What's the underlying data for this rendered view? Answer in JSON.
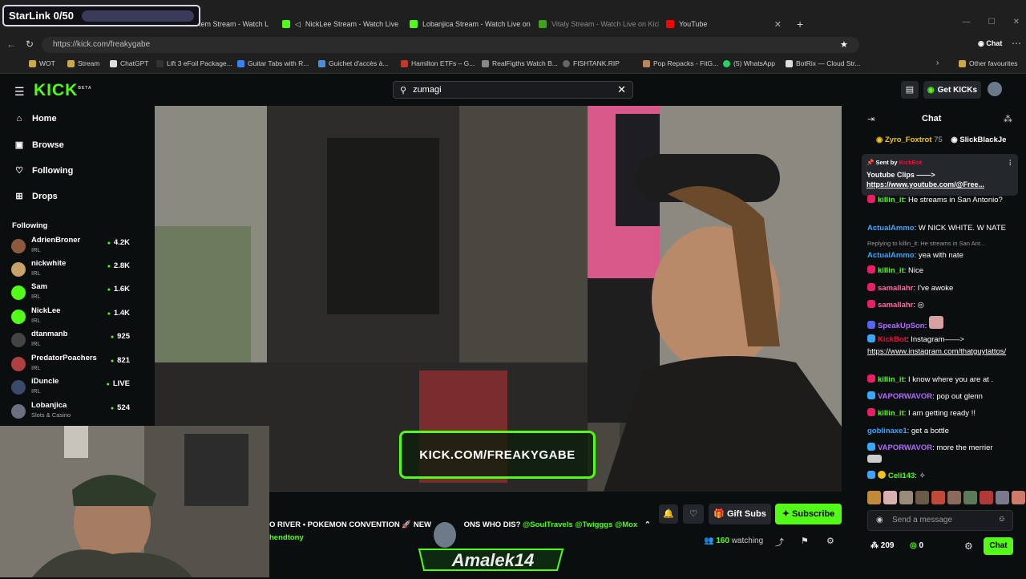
{
  "overlay": {
    "starlink_label": "StarLink 0/50"
  },
  "browser": {
    "tabs": [
      {
        "label": "tem Stream - Watch L",
        "icon_color": "#53fc18"
      },
      {
        "label": "NickLee Stream - Watch Live",
        "icon_color": "#53fc18"
      },
      {
        "label": "Lobanjica Stream - Watch Live on",
        "icon_color": "#53fc18"
      },
      {
        "label": "Vitaly Stream - Watch Live on Kick",
        "icon_color": "#53fc18"
      },
      {
        "label": "YouTube",
        "icon_color": "#ff0000"
      }
    ],
    "url": "https://kick.com/freakygabe",
    "bookmarks": [
      "WOT",
      "Stream",
      "ChatGPT",
      "Lift 3 eFoil Package...",
      "Guitar Tabs with R...",
      "Guichet d'accès à...",
      "Hamilton ETFs – G...",
      "RealFigths Watch B...",
      "FISHTANK.RIP",
      "Pop Repacks - FitG...",
      "(5) WhatsApp",
      "BotRix — Cloud Str...",
      "Other favourites"
    ]
  },
  "header": {
    "logo": "KICK",
    "logo_beta": "BETA",
    "search_value": "zumagi",
    "get_kicks": "Get KICKs"
  },
  "sidebar": {
    "nav": [
      {
        "label": "Home",
        "icon": "home-icon"
      },
      {
        "label": "Browse",
        "icon": "browse-icon"
      },
      {
        "label": "Following",
        "icon": "heart-icon"
      },
      {
        "label": "Drops",
        "icon": "drops-icon"
      }
    ],
    "following_title": "Following",
    "channels": [
      {
        "name": "AdrienBroner",
        "category": "IRL",
        "viewers": "4.2K",
        "color": "#8b5a3c"
      },
      {
        "name": "nickwhite",
        "category": "IRL",
        "viewers": "2.8K",
        "color": "#c9a26b"
      },
      {
        "name": "Sam",
        "category": "IRL",
        "viewers": "1.6K",
        "color": "#53fc18"
      },
      {
        "name": "NickLee",
        "category": "IRL",
        "viewers": "1.4K",
        "color": "#53fc18"
      },
      {
        "name": "dtanmanb",
        "category": "IRL",
        "viewers": "925",
        "color": "#444444"
      },
      {
        "name": "PredatorPoachers",
        "category": "IRL",
        "viewers": "821",
        "color": "#b04040"
      },
      {
        "name": "iDuncle",
        "category": "IRL",
        "viewers": "LIVE",
        "color": "#3a4a6a"
      },
      {
        "name": "Lobanjica",
        "category": "Slots & Casino",
        "viewers": "524",
        "color": "#6a7080"
      }
    ]
  },
  "stream": {
    "watermark": "KICK.COM/FREAKYGABE",
    "ticker": "O RIVER • POKEMON CONVENTION",
    "ticker_mid": "NEW",
    "ticker_mid2": "ONS WHO DIS?",
    "ticker_tags": "@SoulTravels @Twigggs @Mox",
    "ticker_line2": "hendtony",
    "gift_subs": "Gift Subs",
    "subscribe": "Subscribe",
    "viewers": "160",
    "watching_label": "watching",
    "amalek": "Amalek14"
  },
  "chat": {
    "title": "Chat",
    "leaderboard": [
      {
        "name": "Zyro_Foxtrot",
        "count": "75"
      },
      {
        "name": "SlickBlackJe",
        "count": ""
      }
    ],
    "pinned": {
      "sent_by": "Sent by",
      "sender": "KickBot",
      "text": "Youtube Clips ——>",
      "link": "https://www.youtube.com/@Free..."
    },
    "messages": [
      {
        "user": "killin_it",
        "color": "#53fc18",
        "text": ": He streams in San Antonio?",
        "badge": "#e91e63"
      },
      {
        "user": "ActualAmmo",
        "color": "#3ba6ff",
        "text": ": W NICK WHITE. W NATE",
        "badge": ""
      },
      {
        "reply": "Replying to killin_it: He streams in San Ant...",
        "user": "ActualAmmo",
        "color": "#3ba6ff",
        "text": ": yea with nate",
        "badge": ""
      },
      {
        "user": "killin_it",
        "color": "#53fc18",
        "text": ": Nice",
        "badge": "#e91e63"
      },
      {
        "user": "samallahr",
        "color": "#ff6b9d",
        "text": ": I've awoke",
        "badge": "#e91e63"
      },
      {
        "user": "samallahr",
        "color": "#ff6b9d",
        "text": ":",
        "badge": "#e91e63"
      },
      {
        "user": "SpeakUpSon",
        "color": "#b36bff",
        "text": ":",
        "badge": "#5865f2"
      },
      {
        "user": "KickBot",
        "color": "#e9113c",
        "text": ": Instagram——>",
        "link": "https://www.instagram.com/thatguytattos/",
        "badge": "#3ba6ff"
      },
      {
        "user": "killin_it",
        "color": "#53fc18",
        "text": ": I know where you are at .",
        "badge": "#e91e63"
      },
      {
        "user": "VAPORWAVOR",
        "color": "#b36bff",
        "text": ": pop out glenn",
        "badge": "#3ba6ff"
      },
      {
        "user": "killin_it",
        "color": "#53fc18",
        "text": ": I am getting ready !!",
        "badge": "#e91e63"
      },
      {
        "user": "goblinaxe1",
        "color": "#3ba6ff",
        "text": ": get a bottle",
        "badge": ""
      },
      {
        "user": "VAPORWAVOR",
        "color": "#b36bff",
        "text": ": more the merrier",
        "badge": "#3ba6ff"
      },
      {
        "user": "Celi143",
        "color": "#53fc18",
        "text": ":",
        "badge": "#3ba6ff"
      }
    ],
    "input_placeholder": "Send a message",
    "send_label": "Chat",
    "user_count": "209",
    "kicks_count": "0"
  }
}
